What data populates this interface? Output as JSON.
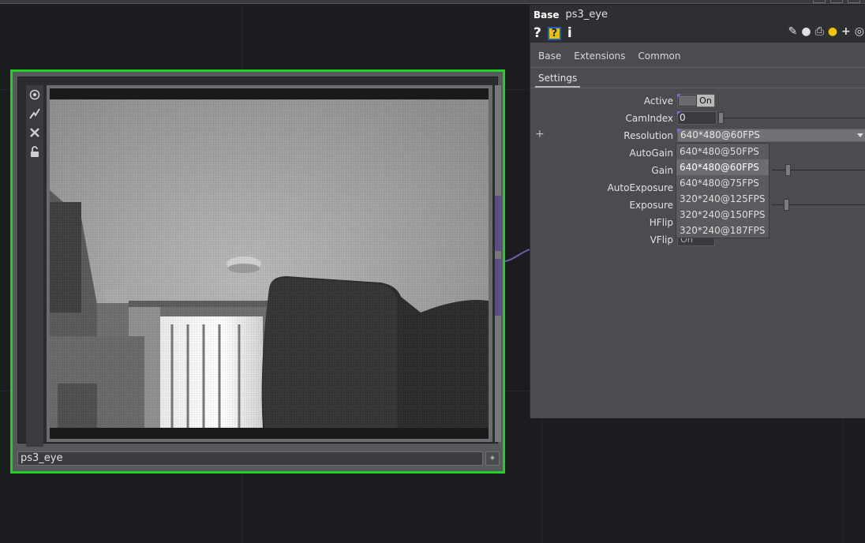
{
  "node": {
    "name": "ps3_eye",
    "toolbar_icons": [
      "viewer-active-icon",
      "wire-icon",
      "close-icon",
      "lock-icon"
    ]
  },
  "panel": {
    "op_type": "Base",
    "op_name": "ps3_eye",
    "help_q": "?",
    "help_box": "?",
    "info": "i",
    "tabs": [
      "Base",
      "Extensions",
      "Common"
    ],
    "subtab": "Settings",
    "params": {
      "active": {
        "label": "Active",
        "value": "On"
      },
      "camindex": {
        "label": "CamIndex",
        "value": "0"
      },
      "resolution": {
        "label": "Resolution",
        "value": "640*480@60FPS"
      },
      "autogain": {
        "label": "AutoGain"
      },
      "gain": {
        "label": "Gain"
      },
      "autoexposure": {
        "label": "AutoExposure"
      },
      "exposure": {
        "label": "Exposure"
      },
      "hflip": {
        "label": "HFlip"
      },
      "vflip": {
        "label": "VFlip",
        "value": "On"
      }
    },
    "plus": "+"
  },
  "dropdown": {
    "options": [
      "640*480@50FPS",
      "640*480@60FPS",
      "640*480@75FPS",
      "320*240@125FPS",
      "320*240@150FPS",
      "320*240@187FPS"
    ],
    "selected_index": 1
  },
  "colors": {
    "node_border": "#1fd21f",
    "wire": "#6b5fb0",
    "flag": "#7d6fd1"
  }
}
